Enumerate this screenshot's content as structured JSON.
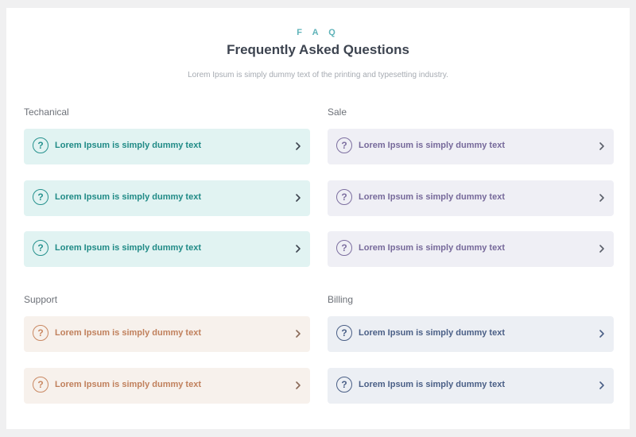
{
  "header": {
    "eyebrow": "F A Q",
    "title": "Frequently Asked Questions",
    "subtitle": "Lorem Ipsum is simply dummy text of the printing and typesetting industry."
  },
  "groups": {
    "technical": {
      "label": "Techanical",
      "items": [
        "Lorem Ipsum is simply dummy text",
        "Lorem Ipsum is simply dummy text",
        "Lorem Ipsum is simply dummy text"
      ]
    },
    "sale": {
      "label": "Sale",
      "items": [
        "Lorem Ipsum is simply dummy text",
        "Lorem Ipsum is simply dummy text",
        "Lorem Ipsum is simply dummy text"
      ]
    },
    "support": {
      "label": "Support",
      "items": [
        "Lorem Ipsum is simply dummy text",
        "Lorem Ipsum is simply dummy text"
      ]
    },
    "billing": {
      "label": "Billing",
      "items": [
        "Lorem Ipsum is simply dummy text",
        "Lorem Ipsum is simply dummy text"
      ]
    }
  },
  "icons": {
    "question": "?",
    "chevron": "chevron-right-icon"
  },
  "colors": {
    "teal": "#1f8a86",
    "lavender": "#76699a",
    "peach": "#c0805c",
    "slate": "#4a5f86",
    "eyebrow": "#5fb3b9"
  }
}
